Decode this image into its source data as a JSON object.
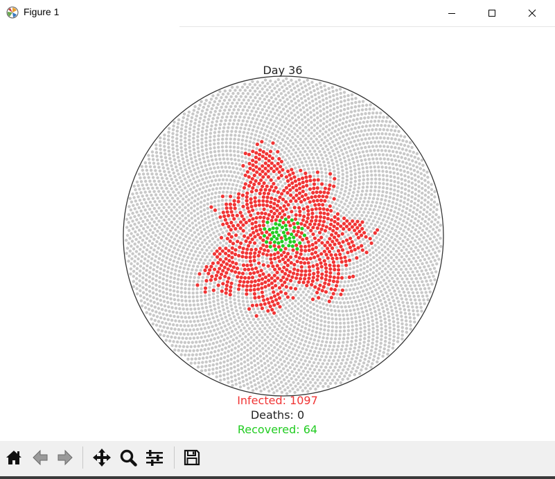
{
  "window": {
    "title": "Figure 1",
    "icons": {
      "app": "matplotlib-icon",
      "minimize": "minimize-icon",
      "maximize": "maximize-icon",
      "close": "close-icon"
    }
  },
  "chart_data": {
    "type": "scatter",
    "title": "Day 36",
    "layout": "sunflower-spiral in circular boundary",
    "axes_visible": false,
    "grid": false,
    "population_region": {
      "shape": "circle",
      "radius_units": 1.0
    },
    "series": [
      {
        "name": "",
        "status": "healthy",
        "color": "#c8c8c8",
        "region": "outer disc, radius 0 to 1.0 (background points)"
      },
      {
        "name": "",
        "status": "infected",
        "color": "#f03434",
        "count": 1097,
        "region": "central ring, radius ~0.05 to ~0.55 with ragged spiral edge"
      },
      {
        "name": "",
        "status": "recovered",
        "color": "#22cc22",
        "count": 64,
        "region": "inner core, radius ~0 to ~0.2"
      }
    ],
    "annotations": {
      "infected": {
        "label": "Infected: 1097",
        "color": "#f03434"
      },
      "deaths": {
        "label": "Deaths: 0",
        "color": "#222222"
      },
      "recovered": {
        "label": "Recovered: 64",
        "color": "#22cc22"
      }
    }
  },
  "toolbar": {
    "buttons": [
      {
        "name": "home-button",
        "icon": "home-icon"
      },
      {
        "name": "back-button",
        "icon": "arrow-left-icon"
      },
      {
        "name": "forward-button",
        "icon": "arrow-right-icon"
      },
      {
        "name": "pan-button",
        "icon": "move-icon"
      },
      {
        "name": "zoom-button",
        "icon": "magnifier-icon"
      },
      {
        "name": "configure-subplots-button",
        "icon": "sliders-icon"
      },
      {
        "name": "save-button",
        "icon": "floppy-disk-icon"
      }
    ]
  }
}
